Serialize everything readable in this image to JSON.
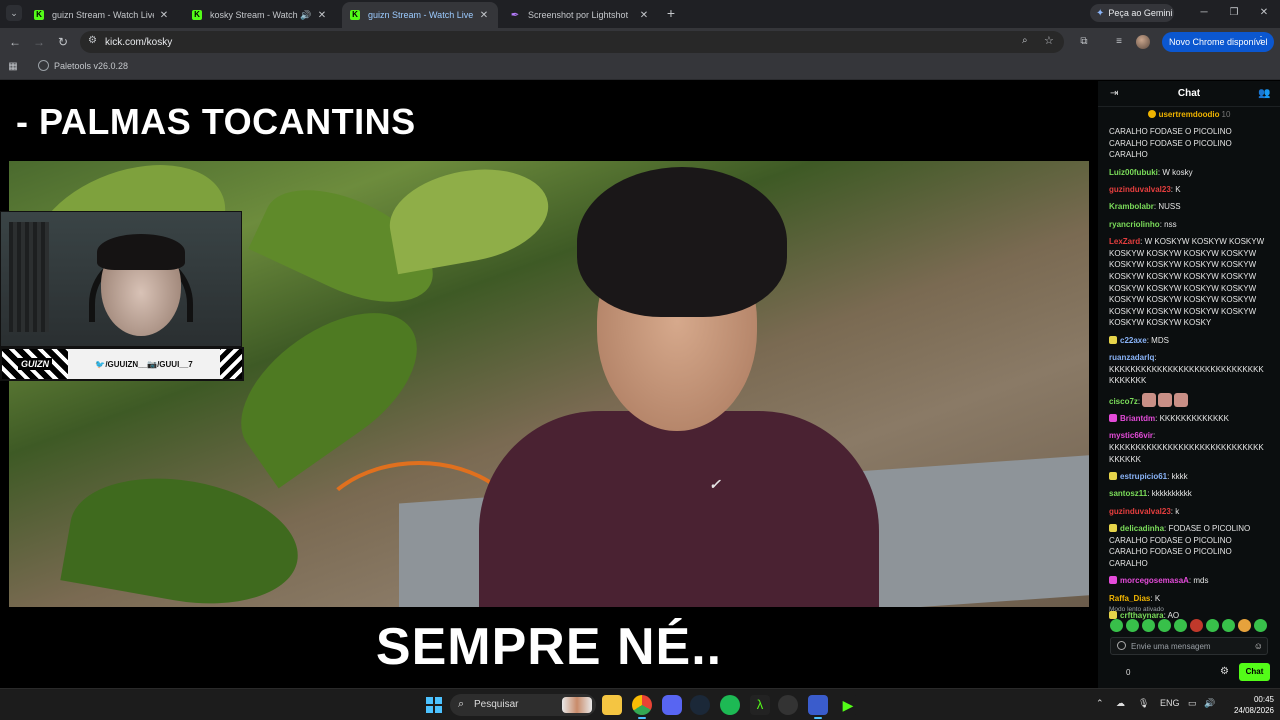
{
  "browser": {
    "tabs": [
      {
        "title": "guizn Stream - Watch Live on K",
        "active": false
      },
      {
        "title": "kosky Stream - Watch Live o",
        "active": false
      },
      {
        "title": "guizn Stream - Watch Live on K",
        "active": true
      },
      {
        "title": "Screenshot por Lightshot",
        "active": false
      }
    ],
    "gemini_label": "Peça ao Gemini",
    "url": "kick.com/kosky",
    "update_label": "Novo Chrome disponível",
    "bookmark": "Paletools v26.0.28"
  },
  "stream": {
    "top_text": "- PALMAS TOCANTINS",
    "caption": "SEMPRE NÉ..",
    "social_logo": "GUIZN",
    "social_handles": "🐦/GUUIZN__📷/GUUI__7"
  },
  "chat": {
    "title": "Chat",
    "pinned": {
      "user": "usertremdoodio",
      "count": "10"
    },
    "messages": [
      {
        "user": "",
        "color": "#e6e6e6",
        "text": "CARALHO FODASE O PICOLINO CARALHO FODASE O PICOLINO CARALHO"
      },
      {
        "user": "Luiz00fubuki",
        "color": "#7bdc5a",
        "text": "W kosky"
      },
      {
        "user": "guzinduvalval23",
        "color": "#e53e3e",
        "text": "K"
      },
      {
        "user": "Krambolabr",
        "color": "#7bdc5a",
        "text": "NUSS"
      },
      {
        "user": "ryancriolinho",
        "color": "#7bdc5a",
        "text": "nss"
      },
      {
        "user": "LexZard",
        "color": "#e53e3e",
        "text": "W KOSKYW KOSKYW KOSKYW KOSKYW KOSKYW KOSKYW KOSKYW KOSKYW KOSKYW KOSKYW KOSKYW KOSKYW KOSKYW KOSKYW KOSKYW KOSKYW KOSKYW KOSKYW KOSKYW KOSKYW KOSKYW KOSKYW KOSKYW KOSKYW KOSKYW KOSKYW KOSKYW KOSKYW KOSKYW KOSKY"
      },
      {
        "user": "c22axe",
        "color": "#8ab4f8",
        "text": "MDS",
        "badge": "#e6d44a"
      },
      {
        "user": "ruanzadarlq",
        "color": "#8ab4f8",
        "text": "KKKKKKKKKKKKKKKKKKKKKKKKKKKKKKKKKKKK"
      },
      {
        "user": "cisco7z",
        "color": "#7bdc5a",
        "text": "",
        "emotes": 3
      },
      {
        "user": "Briantdm",
        "color": "#e44bd9",
        "text": "KKKKKKKKKKKKK",
        "badge": "#e44bd9"
      },
      {
        "user": "mystic66vir",
        "color": "#e44bd9",
        "text": "KKKKKKKKKKKKKKKKKKKKKKKKKKKKKKKKKKK"
      },
      {
        "user": "estrupicio61",
        "color": "#8ab4f8",
        "text": "kkkk",
        "badge": "#e6d44a"
      },
      {
        "user": "santosz11",
        "color": "#7bdc5a",
        "text": "kkkkkkkkkk"
      },
      {
        "user": "guzinduvalval23",
        "color": "#e53e3e",
        "text": "k"
      },
      {
        "user": "delicadinha",
        "color": "#7bdc5a",
        "text": "FODASE O PICOLINO CARALHO FODASE O PICOLINO CARALHO FODASE O PICOLINO CARALHO",
        "badge": "#e6d44a"
      },
      {
        "user": "morcegosemasaA",
        "color": "#e44bd9",
        "text": "mds",
        "badge": "#e44bd9"
      },
      {
        "user": "Raffa_Dias",
        "color": "#f0b400",
        "text": "K"
      },
      {
        "user": "crfthaynara",
        "color": "#7bdc5a",
        "text": "AO",
        "badge": "#e6d44a"
      }
    ],
    "slow_mode": "Modo lento ativado",
    "input_placeholder": "Envie uma mensagem",
    "count": "0",
    "send_label": "Chat"
  },
  "taskbar": {
    "search_label": "Pesquisar",
    "lang": "ENG",
    "time": "00:45",
    "date": "24/08/2026"
  }
}
